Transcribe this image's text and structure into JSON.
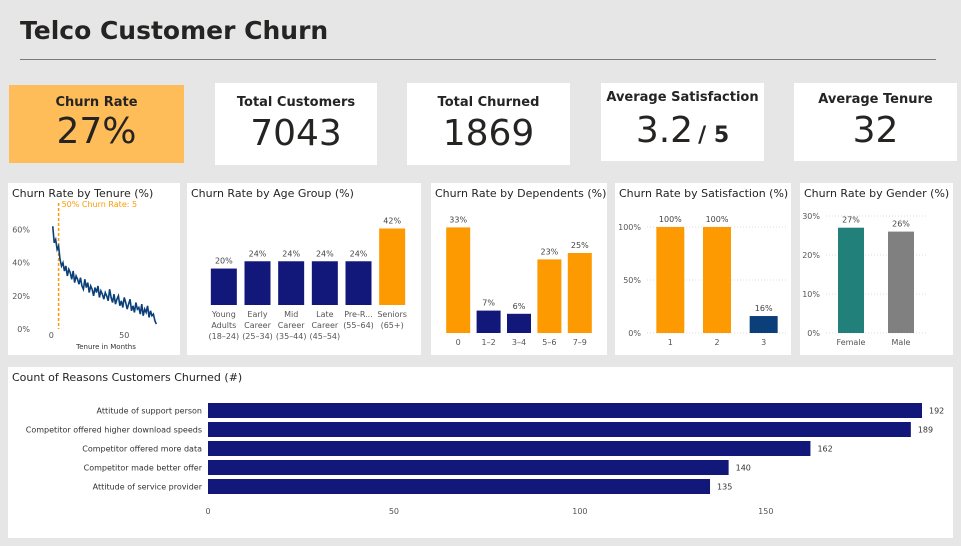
{
  "title": "Telco Customer Churn",
  "kpis": {
    "churn_rate": {
      "label": "Churn Rate",
      "value": "27%"
    },
    "total_customers": {
      "label": "Total Customers",
      "value": "7043"
    },
    "total_churned": {
      "label": "Total Churned",
      "value": "1869"
    },
    "avg_satisfaction": {
      "label": "Average Satisfaction",
      "value": "3.2",
      "suffix": "/ 5"
    },
    "avg_tenure": {
      "label": "Average Tenure",
      "value": "32"
    }
  },
  "colors": {
    "orange": "#fe9a01",
    "navy": "#12177a",
    "teal": "#21807a",
    "gray": "#808080",
    "blue": "#0a3f7a",
    "highlight": "#ffbd59"
  },
  "chart_data": [
    {
      "type": "line",
      "title": "Churn Rate by Tenure (%)",
      "xlabel": "Tenure in Months",
      "x_ticks": [
        0,
        50
      ],
      "y_ticks": [
        "0%",
        "20%",
        "40%",
        "60%"
      ],
      "ylim": [
        0,
        70
      ],
      "xlim": [
        -5,
        80
      ],
      "annotation": "50% Churn Rate: 5",
      "annotation_x": 5,
      "x": [
        1,
        2,
        3,
        4,
        5,
        6,
        7,
        8,
        9,
        10,
        11,
        12,
        13,
        14,
        15,
        16,
        17,
        18,
        19,
        20,
        21,
        22,
        23,
        24,
        25,
        26,
        27,
        28,
        29,
        30,
        31,
        32,
        33,
        34,
        35,
        36,
        37,
        38,
        39,
        40,
        41,
        42,
        43,
        44,
        45,
        46,
        47,
        48,
        49,
        50,
        51,
        52,
        53,
        54,
        55,
        56,
        57,
        58,
        59,
        60,
        61,
        62,
        63,
        64,
        65,
        66,
        67,
        68,
        69,
        70,
        71,
        72
      ],
      "values": [
        62,
        52,
        54,
        48,
        50,
        42,
        38,
        40,
        35,
        38,
        32,
        36,
        34,
        30,
        35,
        28,
        32,
        30,
        27,
        31,
        26,
        24,
        30,
        25,
        28,
        22,
        26,
        24,
        20,
        25,
        22,
        26,
        19,
        23,
        21,
        18,
        22,
        20,
        17,
        24,
        19,
        16,
        21,
        15,
        18,
        20,
        14,
        17,
        13,
        19,
        16,
        12,
        15,
        18,
        11,
        14,
        10,
        16,
        12,
        13,
        9,
        15,
        8,
        12,
        10,
        14,
        7,
        11,
        8,
        9,
        5,
        3
      ]
    },
    {
      "type": "bar",
      "title": "Churn Rate by Age Group (%)",
      "categories": [
        [
          "Young",
          "Adults",
          "(18–24)"
        ],
        [
          "Early",
          "Career",
          "(25–34)"
        ],
        [
          "Mid",
          "Career",
          "(35–44)"
        ],
        [
          "Late",
          "Career",
          "(45–54)"
        ],
        [
          "Pre-R...",
          "(55–64)"
        ],
        [
          "Seniors",
          "(65+)"
        ]
      ],
      "values": [
        20,
        24,
        24,
        24,
        24,
        42
      ],
      "labels": [
        "20%",
        "24%",
        "24%",
        "24%",
        "24%",
        "42%"
      ],
      "ylim": [
        0,
        45
      ],
      "colors": [
        "navy",
        "navy",
        "navy",
        "navy",
        "navy",
        "orange"
      ]
    },
    {
      "type": "bar",
      "title": "Churn Rate by Dependents (%)",
      "categories": [
        "0",
        "1–2",
        "3–4",
        "5–6",
        "7–9"
      ],
      "values": [
        33,
        7,
        6,
        23,
        25
      ],
      "labels": [
        "33%",
        "7%",
        "6%",
        "23%",
        "25%"
      ],
      "ylim": [
        0,
        35
      ],
      "colors": [
        "orange",
        "navy",
        "navy",
        "orange",
        "orange"
      ]
    },
    {
      "type": "bar",
      "title": "Churn Rate by Satisfaction (%)",
      "categories": [
        "1",
        "2",
        "3"
      ],
      "values": [
        100,
        100,
        16
      ],
      "labels": [
        "100%",
        "100%",
        "16%"
      ],
      "y_ticks": [
        "0%",
        "50%",
        "100%"
      ],
      "ylim": [
        0,
        100
      ],
      "colors": [
        "orange",
        "orange",
        "blue"
      ]
    },
    {
      "type": "bar",
      "title": "Churn Rate by Gender (%)",
      "categories": [
        "Female",
        "Male"
      ],
      "values": [
        27,
        26
      ],
      "labels": [
        "27%",
        "26%"
      ],
      "y_ticks": [
        "0%",
        "10%",
        "20%",
        "30%"
      ],
      "ylim": [
        0,
        30
      ],
      "colors": [
        "teal",
        "gray"
      ]
    },
    {
      "type": "bar",
      "orientation": "horizontal",
      "title": "Count of Reasons Customers Churned (#)",
      "categories": [
        "Attitude of support person",
        "Competitor offered higher download speeds",
        "Competitor offered more data",
        "Competitor made better offer",
        "Attitude of service provider"
      ],
      "values": [
        192,
        189,
        162,
        140,
        135
      ],
      "x_ticks": [
        0,
        50,
        100,
        150
      ],
      "xlim": [
        0,
        192
      ]
    }
  ]
}
